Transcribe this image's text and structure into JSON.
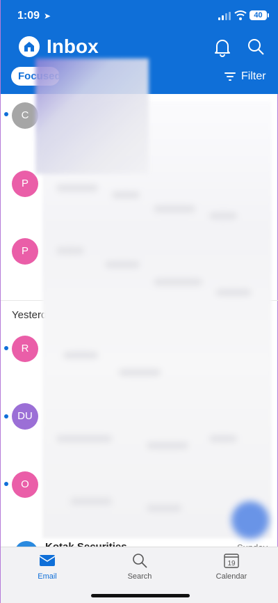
{
  "status": {
    "time": "1:09",
    "battery": "40"
  },
  "header": {
    "title": "Inbox",
    "focused_label": "Focused",
    "filter_label": "Filter"
  },
  "messages": [
    {
      "initial": "C",
      "color": "#a6a6a6",
      "unread": true
    },
    {
      "initial": "P",
      "color": "#ea5ea8",
      "unread": false
    },
    {
      "initial": "P",
      "color": "#ea5ea8",
      "unread": false
    }
  ],
  "section": {
    "label": "Yesterday"
  },
  "messages_yesterday": [
    {
      "initial": "R",
      "color": "#ea5ea8",
      "unread": true
    },
    {
      "initial": "DU",
      "color": "#9b6fd6",
      "unread": true
    },
    {
      "initial": "O",
      "color": "#ea5ea8",
      "unread": true
    }
  ],
  "last_row": {
    "name": "Kotak Securities",
    "day": "Sunday"
  },
  "tabs": [
    {
      "label": "Email",
      "active": true
    },
    {
      "label": "Search",
      "active": false
    },
    {
      "label": "Calendar",
      "active": false,
      "day": "19"
    }
  ]
}
